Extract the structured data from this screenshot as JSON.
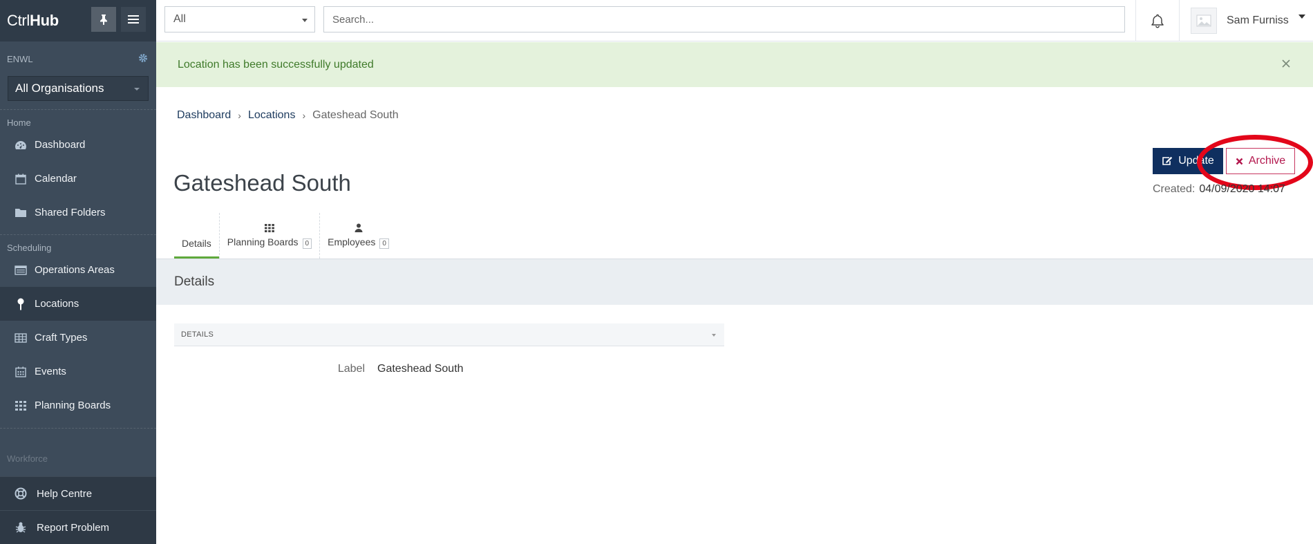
{
  "brand": {
    "prefix": "Ctrl",
    "bold": "Hub"
  },
  "org": {
    "code": "ENWL",
    "selected": "All Organisations"
  },
  "sidebar": {
    "sections": [
      {
        "label": "Home",
        "items": [
          {
            "label": "Dashboard",
            "icon": "dashboard-icon"
          },
          {
            "label": "Calendar",
            "icon": "calendar-icon"
          },
          {
            "label": "Shared Folders",
            "icon": "folder-icon"
          }
        ]
      },
      {
        "label": "Scheduling",
        "items": [
          {
            "label": "Operations Areas",
            "icon": "operations-icon"
          },
          {
            "label": "Locations",
            "icon": "location-pin-icon",
            "active": true
          },
          {
            "label": "Craft Types",
            "icon": "table-icon"
          },
          {
            "label": "Events",
            "icon": "calendar-grid-icon"
          },
          {
            "label": "Planning Boards",
            "icon": "grid-icon"
          }
        ]
      },
      {
        "label": "Workforce"
      }
    ],
    "bottom": [
      {
        "label": "Help Centre",
        "icon": "lifebuoy-icon"
      },
      {
        "label": "Report Problem",
        "icon": "bug-icon"
      }
    ]
  },
  "topbar": {
    "filter_value": "All",
    "search_placeholder": "Search...",
    "user_name": "Sam Furniss"
  },
  "alert": {
    "message": "Location has been successfully updated"
  },
  "breadcrumb": {
    "items": [
      "Dashboard",
      "Locations"
    ],
    "current": "Gateshead South"
  },
  "page": {
    "title": "Gateshead South",
    "actions": {
      "update_label": "Update",
      "archive_label": "Archive"
    },
    "created_label": "Created:",
    "created_value": "04/09/2020 14:07"
  },
  "tabs": [
    {
      "label": "Details",
      "active": true
    },
    {
      "label": "Planning Boards",
      "count": "0",
      "icon": "grid-icon"
    },
    {
      "label": "Employees",
      "count": "0",
      "icon": "user-icon"
    }
  ],
  "details": {
    "section_title": "Details",
    "panel_title": "DETAILS",
    "fields": [
      {
        "label": "Label",
        "value": "Gateshead South"
      }
    ]
  },
  "colors": {
    "sidebar": "#3d4b5a",
    "primary": "#0f2f5f",
    "danger": "#b3174d",
    "success_bg": "#e4f2dc",
    "annotation": "#e3061a"
  }
}
